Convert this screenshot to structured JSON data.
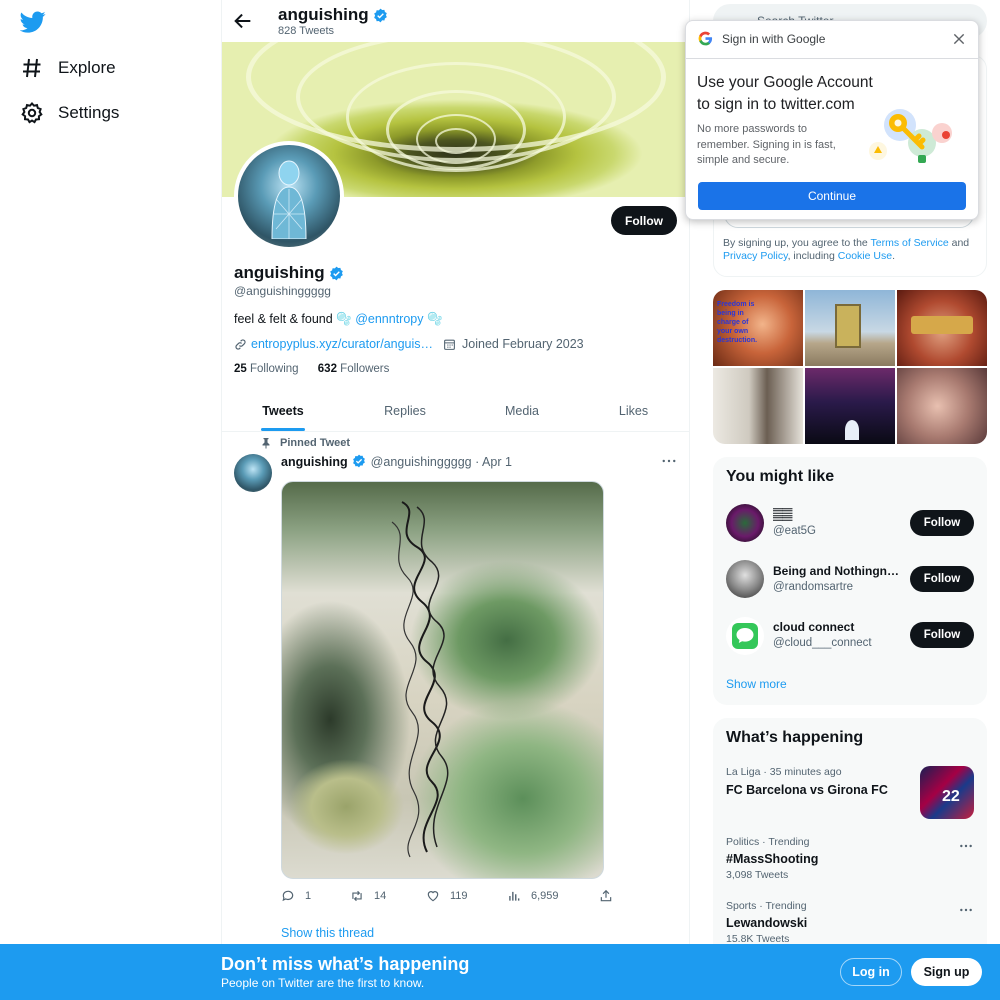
{
  "nav": {
    "logo": "twitter-bird-icon",
    "items": [
      {
        "label": "Explore",
        "icon": "hashtag-icon"
      },
      {
        "label": "Settings",
        "icon": "gear-icon"
      }
    ]
  },
  "header": {
    "name": "anguishing",
    "tweet_count": "828 Tweets"
  },
  "profile": {
    "name": "anguishing",
    "handle": "@anguishinggggg",
    "bio_text": "feel & felt & found 🫧",
    "bio_mention": "@ennntropy",
    "bio_tail": "🫧",
    "link": "entropyplus.xyz/curator/anguis…",
    "joined": "Joined February 2023",
    "following_count": "25",
    "following_label": "Following",
    "followers_count": "632",
    "followers_label": "Followers",
    "follow_label": "Follow"
  },
  "tabs": [
    "Tweets",
    "Replies",
    "Media",
    "Likes"
  ],
  "tweet": {
    "pinned_label": "Pinned Tweet",
    "name": "anguishing",
    "handle_date": "@anguishinggggg · Apr 1",
    "replies": "1",
    "retweets": "14",
    "likes": "119",
    "views": "6,959",
    "show_thread": "Show this thread"
  },
  "search": {
    "placeholder": "Search Twitter"
  },
  "google_popup": {
    "header": "Sign in with Google",
    "title_line1": "Use your Google Account",
    "title_line2": "to sign in to twitter.com",
    "body": "No more passwords to remember. Signing in is fast, simple and secure.",
    "button": "Continue"
  },
  "signup_terms": {
    "prefix": "By signing up, you agree to the ",
    "tos": "Terms of Service",
    "and": " and ",
    "privacy": "Privacy Policy",
    "mid": ", including ",
    "cookie": "Cookie Use",
    "end": "."
  },
  "media_grid": {
    "cell1_text": "Freedom is being in charge of your own destruction."
  },
  "who_to_follow": {
    "title": "You might like",
    "users": [
      {
        "name": "𝄛𝄛",
        "handle": "@eat5G"
      },
      {
        "name": "Being and Nothingn…",
        "handle": "@randomsartre"
      },
      {
        "name": "cloud connect",
        "handle": "@cloud___connect"
      }
    ],
    "follow_label": "Follow",
    "show_more": "Show more"
  },
  "trends": {
    "title": "What’s happening",
    "items": [
      {
        "context": "La Liga · 35 minutes ago",
        "title": "FC Barcelona vs Girona FC",
        "count": ""
      },
      {
        "context": "Politics · Trending",
        "title": "#MassShooting",
        "count": "3,098 Tweets"
      },
      {
        "context": "Sports · Trending",
        "title": "Lewandowski",
        "count": "15.8K Tweets"
      }
    ]
  },
  "bottom_bar": {
    "title": "Don’t miss what’s happening",
    "subtitle": "People on Twitter are the first to know.",
    "login": "Log in",
    "signup": "Sign up"
  },
  "colors": {
    "accent": "#1d9bf0",
    "google_blue": "#1a73e8",
    "text_primary": "#0f1419",
    "text_secondary": "#536471"
  }
}
